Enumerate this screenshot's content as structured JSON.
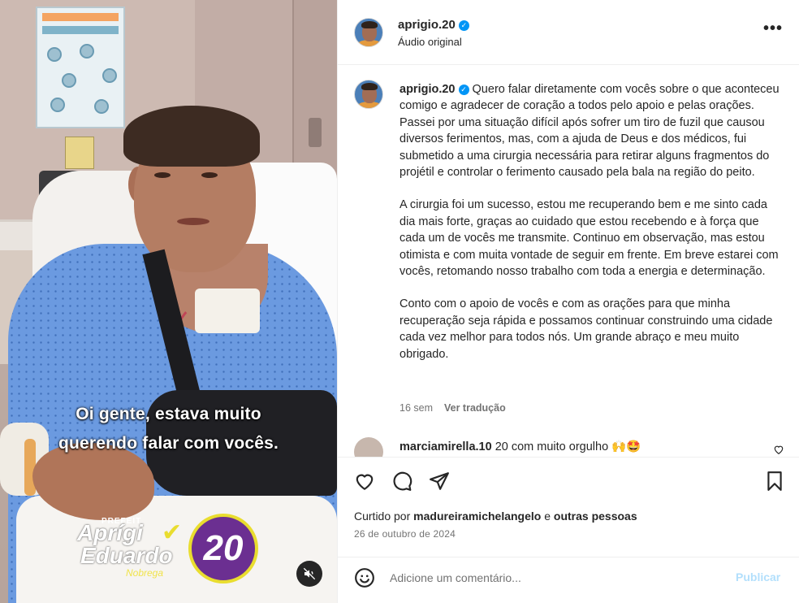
{
  "post": {
    "username": "aprigio.20",
    "audio": "Áudio original",
    "more_label": "•••"
  },
  "video": {
    "subtitle_line1": "Oi gente, estava muito",
    "subtitle_line2": "querendo falar com vocês.",
    "logo_prefix": "PREFEIT",
    "logo_name1": "Aprígi",
    "logo_name2": "Eduardo",
    "logo_number": "20",
    "logo_tag": "Nobrega"
  },
  "caption": {
    "username": "aprigio.20",
    "paragraph1": "Quero falar diretamente com vocês sobre o que aconteceu comigo e agradecer de coração a todos pelo apoio e pelas orações. Passei por uma situação difícil após sofrer um tiro de fuzil que causou diversos ferimentos, mas, com a ajuda de Deus e dos médicos, fui submetido a uma cirurgia necessária para retirar alguns fragmentos do projétil e controlar o ferimento causado pela bala na região do peito.",
    "paragraph2": "A cirurgia foi um sucesso, estou me recuperando bem e me sinto cada dia mais forte, graças ao cuidado que estou recebendo e à força que cada um de vocês me transmite. Continuo em observação, mas estou otimista e com muita vontade de seguir em frente. Em breve estarei com vocês, retomando nosso trabalho com toda a energia e determinação.",
    "paragraph3": "Conto com o apoio de vocês e com as orações para que minha recuperação seja rápida e possamos continuar construindo uma cidade cada vez melhor para todos nós. Um grande abraço e meu muito obrigado.",
    "time": "16 sem",
    "translate": "Ver tradução"
  },
  "comment": {
    "username": "marciamirella.10",
    "text": "20 com muito orgulho 🙌🤩"
  },
  "likes": {
    "prefix": "Curtido por",
    "user": "madureiramichelangelo",
    "connector": "e",
    "others": "outras pessoas"
  },
  "date": "26 de outubro de 2024",
  "add_comment": {
    "placeholder": "Adicione um comentário...",
    "publish": "Publicar"
  },
  "icons": [
    "verified-badge-icon",
    "more-options-icon",
    "heart-icon",
    "comment-icon",
    "share-icon",
    "bookmark-icon",
    "emoji-icon",
    "mute-icon",
    "heart-small-icon"
  ],
  "colors": {
    "verified": "#0095f6",
    "text": "#262626",
    "secondary": "#737373",
    "publish_disabled": "#b2dffc"
  }
}
